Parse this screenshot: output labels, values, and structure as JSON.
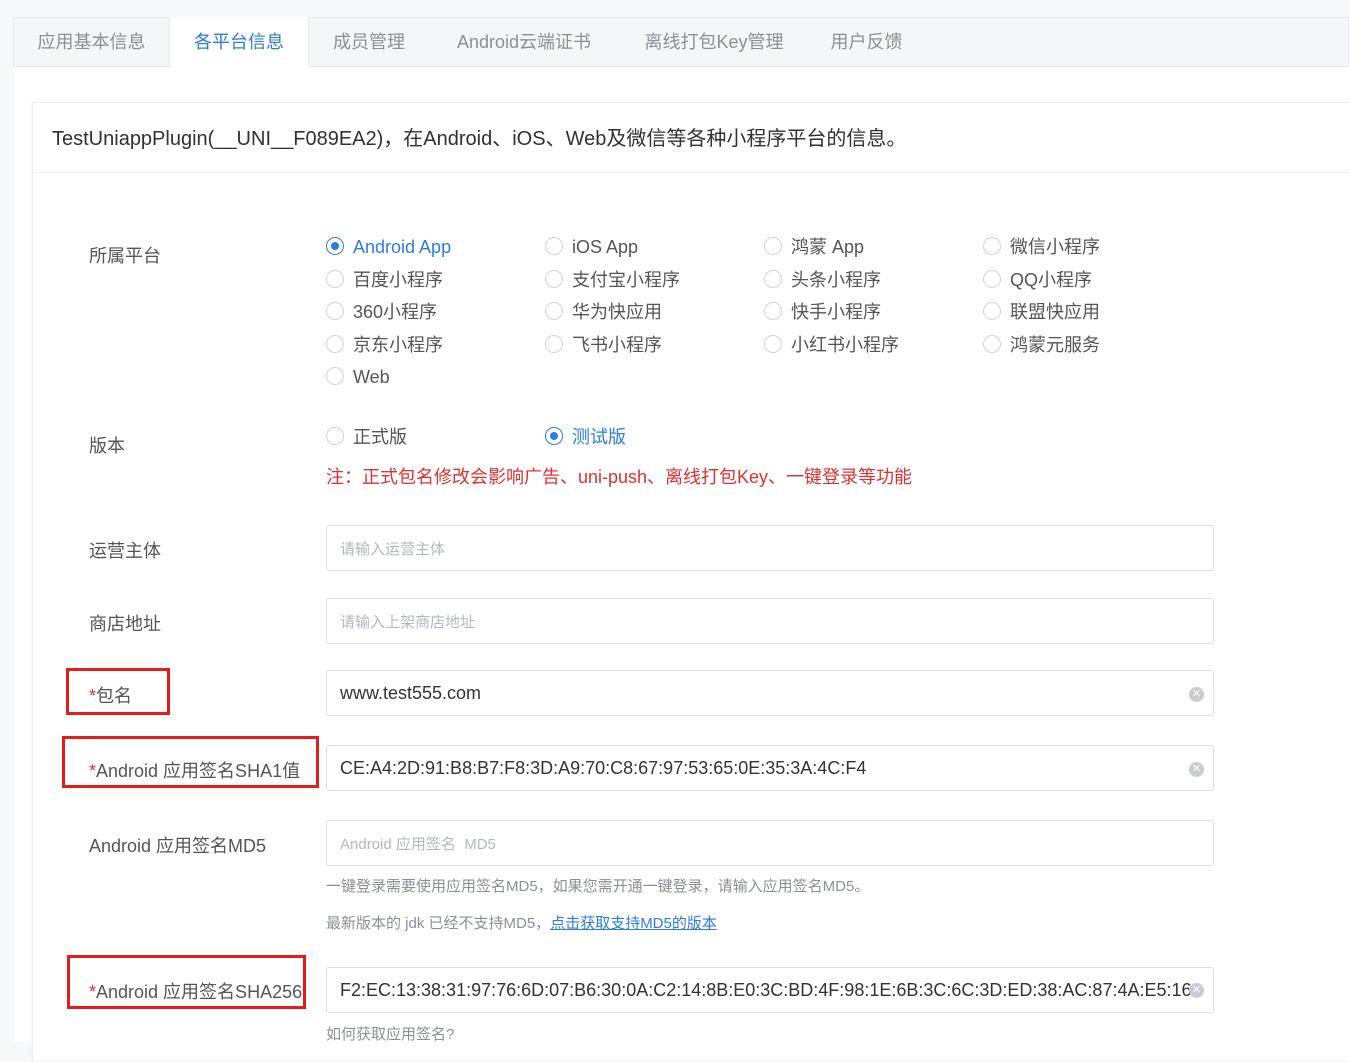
{
  "tabs": [
    {
      "label": "应用基本信息",
      "active": false
    },
    {
      "label": "各平台信息",
      "active": true
    },
    {
      "label": "成员管理",
      "active": false
    },
    {
      "label": "Android云端证书",
      "active": false
    },
    {
      "label": "离线打包Key管理",
      "active": false
    },
    {
      "label": "用户反馈",
      "active": false
    }
  ],
  "header": {
    "text": "TestUniappPlugin(__UNI__F089EA2)，在Android、iOS、Web及微信等各种小程序平台的信息。"
  },
  "platform": {
    "label": "所属平台",
    "selected": "Android App",
    "options": [
      "Android App",
      "iOS App",
      "鸿蒙 App",
      "微信小程序",
      "百度小程序",
      "支付宝小程序",
      "头条小程序",
      "QQ小程序",
      "360小程序",
      "华为快应用",
      "快手小程序",
      "联盟快应用",
      "京东小程序",
      "飞书小程序",
      "小红书小程序",
      "鸿蒙元服务",
      "Web"
    ]
  },
  "version": {
    "label": "版本",
    "options": [
      "正式版",
      "测试版"
    ],
    "selected": "测试版",
    "note": "注：正式包名修改会影响广告、uni-push、离线打包Key、一键登录等功能"
  },
  "operator": {
    "label": "运营主体",
    "placeholder": "请输入运营主体",
    "value": ""
  },
  "store": {
    "label": "商店地址",
    "placeholder": "请输入上架商店地址",
    "value": ""
  },
  "package": {
    "required": "*",
    "label": "包名",
    "value": "www.test555.com"
  },
  "sha1": {
    "required": "*",
    "label": "Android 应用签名SHA1值",
    "value": "CE:A4:2D:91:B8:B7:F8:3D:A9:70:C8:67:97:53:65:0E:35:3A:4C:F4"
  },
  "md5": {
    "label": "Android 应用签名MD5",
    "placeholder": "Android 应用签名  MD5",
    "value": "",
    "hint1": "一键登录需要使用应用签名MD5，如果您需开通一键登录，请输入应用签名MD5。",
    "hint2_text": "最新版本的 jdk 已经不支持MD5，",
    "hint2_link": "点击获取支持MD5的版本"
  },
  "sha256": {
    "required": "*",
    "label": "Android 应用签名SHA256",
    "value": "F2:EC:13:38:31:97:76:6D:07:B6:30:0A:C2:14:8B:E0:3C:BD:4F:98:1E:6B:3C:6C:3D:ED:38:AC:87:4A:E5:16",
    "hint": "如何获取应用签名?"
  },
  "colors": {
    "accent": "#2f7ddb",
    "danger": "#e0302f"
  },
  "icons": {
    "clear": "clear-circle-icon"
  }
}
